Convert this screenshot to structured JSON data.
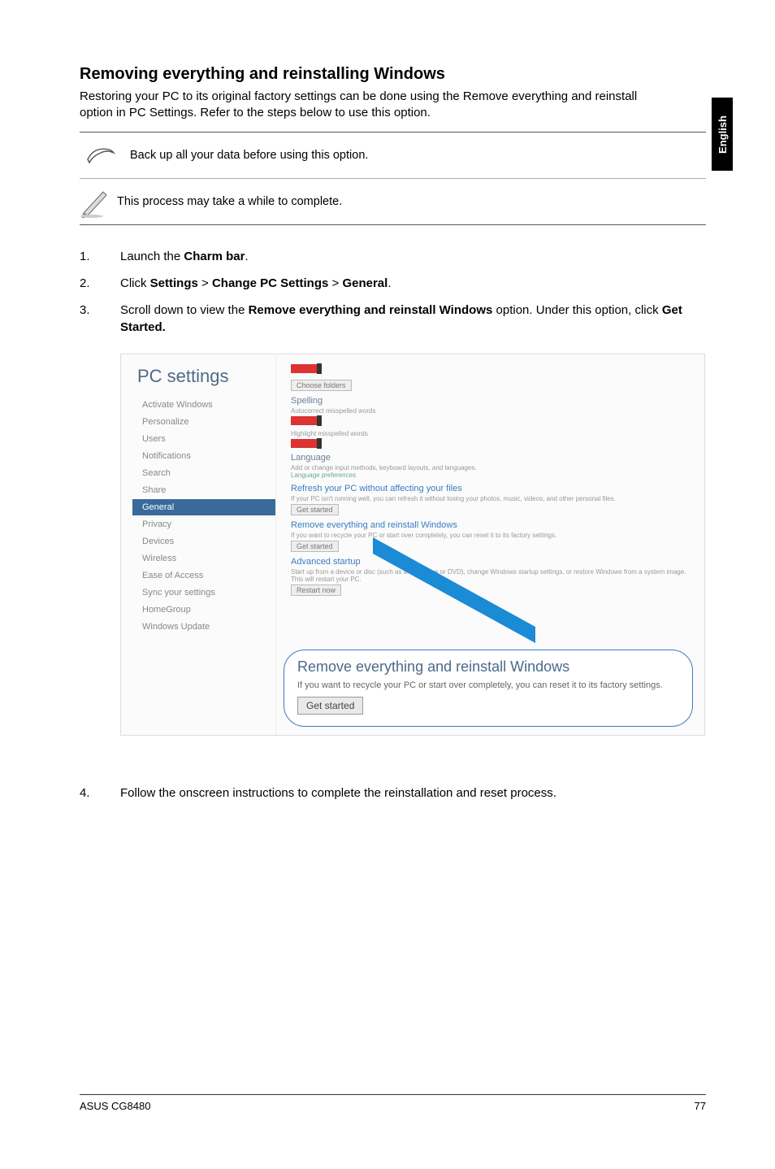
{
  "title": "Removing everything and reinstalling Windows",
  "intro": "Restoring your PC to its original factory settings can be done using the Remove everything and reinstall option in PC Settings. Refer to the steps below to use this option.",
  "side_tab": "English",
  "note1": "Back up all your data before using this option.",
  "note2": "This process may take a while to complete.",
  "step1_a": "Launch the ",
  "step1_b": "Charm bar",
  "step1_c": ".",
  "step2_a": "Click ",
  "step2_b": "Settings",
  "step2_c": " > ",
  "step2_d": "Change PC Settings",
  "step2_e": " > ",
  "step2_f": "General",
  "step2_g": ".",
  "step3_a": "Scroll down to view the ",
  "step3_b": "Remove everything and reinstall Windows",
  "step3_c": " option. Under this option, click ",
  "step3_d": "Get Started.",
  "step4": "Follow the onscreen instructions to complete the reinstallation and reset process.",
  "footer_left": "ASUS CG8480",
  "footer_right": "77",
  "ss": {
    "title": "PC settings",
    "nav": [
      "Activate Windows",
      "Personalize",
      "Users",
      "Notifications",
      "Search",
      "Share",
      "General",
      "Privacy",
      "Devices",
      "Wireless",
      "Ease of Access",
      "Sync your settings",
      "HomeGroup",
      "Windows Update"
    ],
    "spelling_h": "Spelling",
    "language_h": "Language",
    "refresh_h": "Refresh your PC without affecting your files",
    "remove_h": "Remove everything and reinstall Windows",
    "advanced_h": "Advanced startup",
    "btn_get": "Get started",
    "btn_restart": "Restart now",
    "callout_title": "Remove everything and reinstall Windows",
    "callout_text": "If you want to recycle your PC or start over completely, you can reset it to its factory settings.",
    "callout_btn": "Get started"
  }
}
